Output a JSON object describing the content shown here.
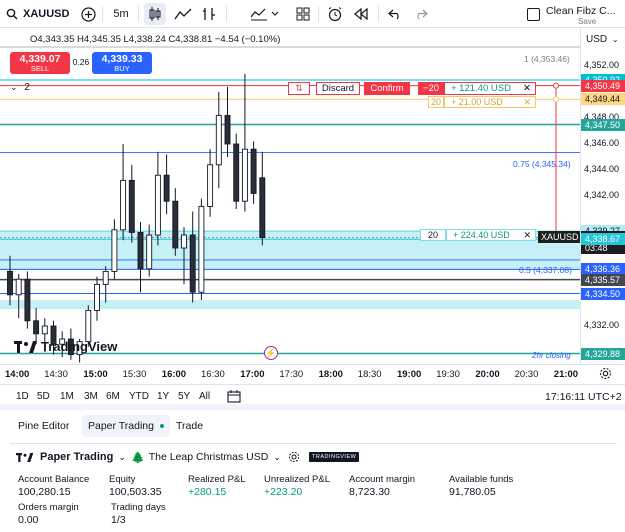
{
  "toolbar": {
    "symbol": "XAUUSD",
    "interval": "5m",
    "layout_name": "Clean Fibz C...",
    "save_label": "Save"
  },
  "header": {
    "ohlc": "O4,343.35 H4,345.35 L4,338.24 C4,338.81 −4.54 (−0.10%)",
    "sell_price": "4,339.07",
    "sell_label": "SELL",
    "spread": "0.26",
    "buy_price": "4,339.33",
    "buy_label": "BUY",
    "qty": "2",
    "currency": "USD"
  },
  "order_line": {
    "discard_label": "Discard",
    "confirm_label": "Confirm",
    "qty": "−20",
    "pnl": "+ 121.40 USD",
    "qty2": "20",
    "pnl2": "+ 21.00 USD"
  },
  "position_line": {
    "qty": "20",
    "pnl": "+ 224.40 USD"
  },
  "fib_labels": {
    "top": "1 (4,353.46)",
    "f075": "0.75 (4,345.34)",
    "f05": "0.5 (4,337.08)",
    "closing": "2hr closing"
  },
  "watermark": "TradingView",
  "price_axis": {
    "labels": [
      "4,352.00",
      "4,348.00",
      "4,346.00",
      "4,344.00",
      "4,342.00",
      "4,332.00"
    ],
    "tags": [
      {
        "text": "4,350.92",
        "color": "#00bcd4"
      },
      {
        "text": "4,350.49",
        "color": "#f23645"
      },
      {
        "text": "4,349.44",
        "color": "#ffd580"
      },
      {
        "text": "4,347.50",
        "color": "#26a69a"
      },
      {
        "text": "4,339.27",
        "color": "#b2ebf2"
      },
      {
        "text": "4,338.81",
        "color": "#1e1e1e"
      },
      {
        "text": "03:48",
        "color": "#1e1e1e"
      },
      {
        "text": "4,338.67",
        "color": "#26c6da"
      },
      {
        "text": "4,336.36",
        "color": "#2962ff"
      },
      {
        "text": "4,335.57",
        "color": "#434651"
      },
      {
        "text": "4,334.50",
        "color": "#2962ff"
      },
      {
        "text": "4,329.88",
        "color": "#26a69a"
      }
    ],
    "symbol_tag": "XAUUSD"
  },
  "time_axis": [
    "14:00",
    "14:30",
    "15:00",
    "15:30",
    "16:00",
    "16:30",
    "17:00",
    "17:30",
    "18:00",
    "18:30",
    "19:00",
    "19:30",
    "20:00",
    "20:30",
    "21:00"
  ],
  "range_buttons": [
    "1D",
    "5D",
    "1M",
    "3M",
    "6M",
    "YTD",
    "1Y",
    "5Y",
    "All"
  ],
  "clock": "17:16:11 UTC+2",
  "bottom_tabs": [
    "Pine Editor",
    "Paper Trading",
    "Trade"
  ],
  "account": {
    "broker": "Paper Trading",
    "account_name": "The Leap Christmas USD",
    "badge": "TRADINGVIEW",
    "metrics": [
      {
        "label": "Account Balance",
        "value": "100,280.15"
      },
      {
        "label": "Equity",
        "value": "100,503.35"
      },
      {
        "label": "Realized P&L",
        "value": "+280.15"
      },
      {
        "label": "Unrealized P&L",
        "value": "+223.20"
      },
      {
        "label": "Account margin",
        "value": "8,723.30"
      },
      {
        "label": "Available funds",
        "value": "91,780.05"
      },
      {
        "label": "Orders margin",
        "value": "0.00"
      },
      {
        "label": "Trading days",
        "value": "1/3"
      }
    ]
  },
  "colors": {
    "accent": "#2962ff",
    "green": "#089981",
    "red": "#f23645",
    "cyan": "#00bcd4"
  },
  "candles": [
    {
      "o": 4336.2,
      "h": 4337.4,
      "l": 4333.6,
      "c": 4334.4
    },
    {
      "o": 4334.4,
      "h": 4336.0,
      "l": 4332.6,
      "c": 4335.6
    },
    {
      "o": 4335.6,
      "h": 4336.2,
      "l": 4331.8,
      "c": 4332.4
    },
    {
      "o": 4332.4,
      "h": 4333.4,
      "l": 4330.6,
      "c": 4331.4
    },
    {
      "o": 4331.4,
      "h": 4332.6,
      "l": 4330.0,
      "c": 4332.0
    },
    {
      "o": 4332.0,
      "h": 4332.4,
      "l": 4329.8,
      "c": 4330.6
    },
    {
      "o": 4330.6,
      "h": 4331.6,
      "l": 4329.6,
      "c": 4331.0
    },
    {
      "o": 4331.0,
      "h": 4331.8,
      "l": 4329.4,
      "c": 4329.8
    },
    {
      "o": 4329.8,
      "h": 4331.0,
      "l": 4329.2,
      "c": 4330.8
    },
    {
      "o": 4330.8,
      "h": 4333.6,
      "l": 4330.4,
      "c": 4333.2
    },
    {
      "o": 4333.2,
      "h": 4335.8,
      "l": 4332.4,
      "c": 4335.2
    },
    {
      "o": 4335.2,
      "h": 4336.6,
      "l": 4333.8,
      "c": 4336.2
    },
    {
      "o": 4336.2,
      "h": 4340.2,
      "l": 4335.6,
      "c": 4339.4
    },
    {
      "o": 4339.4,
      "h": 4346.0,
      "l": 4338.6,
      "c": 4343.2
    },
    {
      "o": 4343.2,
      "h": 4344.4,
      "l": 4338.4,
      "c": 4339.2
    },
    {
      "o": 4339.2,
      "h": 4340.0,
      "l": 4334.6,
      "c": 4336.4
    },
    {
      "o": 4336.4,
      "h": 4339.8,
      "l": 4335.8,
      "c": 4339.0
    },
    {
      "o": 4339.0,
      "h": 4345.4,
      "l": 4338.2,
      "c": 4343.6
    },
    {
      "o": 4343.6,
      "h": 4345.2,
      "l": 4340.6,
      "c": 4341.6
    },
    {
      "o": 4341.6,
      "h": 4342.6,
      "l": 4337.4,
      "c": 4338.0
    },
    {
      "o": 4338.0,
      "h": 4339.6,
      "l": 4335.2,
      "c": 4339.0
    },
    {
      "o": 4339.0,
      "h": 4340.8,
      "l": 4333.8,
      "c": 4334.6
    },
    {
      "o": 4334.6,
      "h": 4341.8,
      "l": 4334.0,
      "c": 4341.2
    },
    {
      "o": 4341.2,
      "h": 4345.6,
      "l": 4340.4,
      "c": 4344.4
    },
    {
      "o": 4344.4,
      "h": 4350.0,
      "l": 4342.6,
      "c": 4348.2
    },
    {
      "o": 4348.2,
      "h": 4350.4,
      "l": 4345.0,
      "c": 4346.0
    },
    {
      "o": 4346.0,
      "h": 4346.8,
      "l": 4341.0,
      "c": 4341.6
    },
    {
      "o": 4341.6,
      "h": 4351.4,
      "l": 4340.8,
      "c": 4345.6
    },
    {
      "o": 4345.6,
      "h": 4346.2,
      "l": 4341.4,
      "c": 4342.2
    },
    {
      "o": 4343.4,
      "h": 4345.4,
      "l": 4338.2,
      "c": 4338.8
    }
  ]
}
